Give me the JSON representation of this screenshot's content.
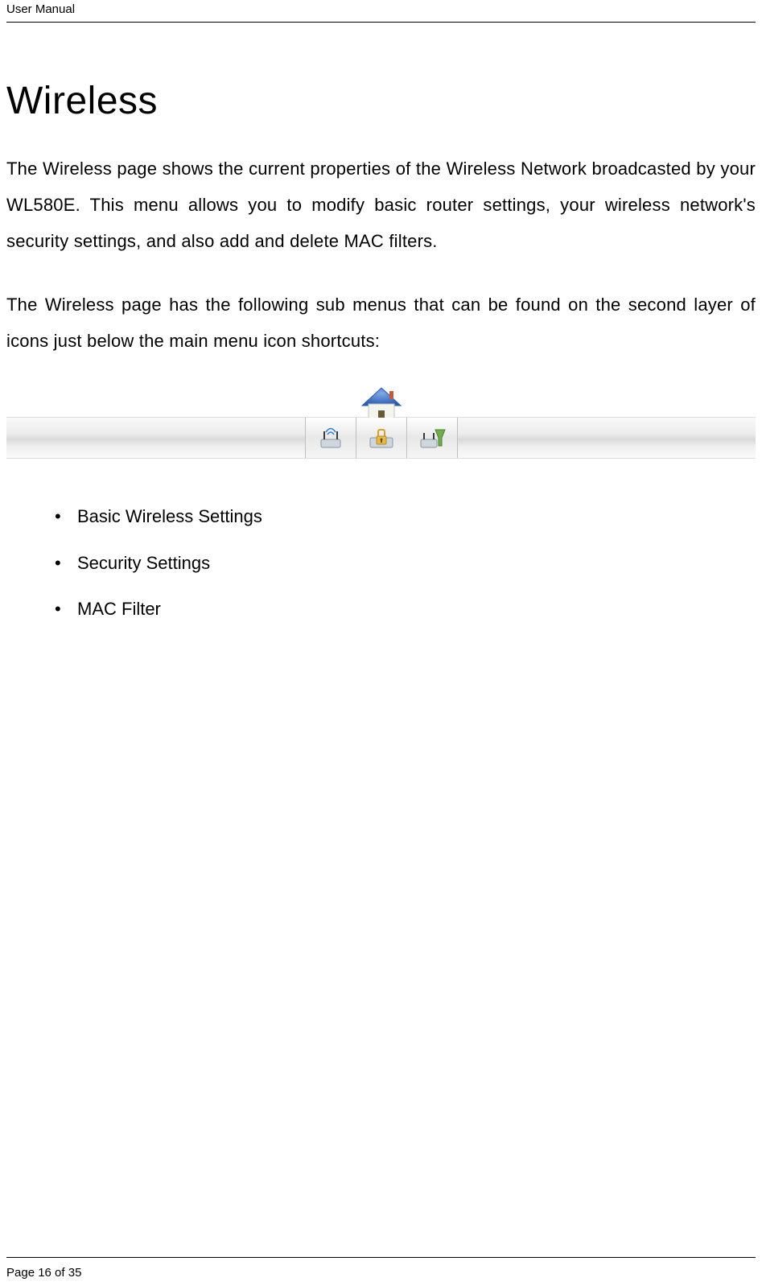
{
  "header": {
    "label": "User Manual"
  },
  "title": "Wireless",
  "paragraphs": {
    "p1": "The Wireless page shows the current properties of the Wireless Network broadcasted by your WL580E. This menu allows you to modify basic router settings, your wireless network's security settings, and also add and delete MAC filters.",
    "p2": "The Wireless page has the following sub menus that can be found on the second layer of icons just below the main menu icon shortcuts:"
  },
  "submenu": {
    "home_icon": "home-icon",
    "items": [
      {
        "name": "basic-wireless-icon"
      },
      {
        "name": "security-icon"
      },
      {
        "name": "mac-filter-icon"
      }
    ]
  },
  "bullets": [
    "Basic Wireless Settings",
    "Security Settings",
    "MAC Filter"
  ],
  "footer": {
    "label": "Page 16 of 35"
  }
}
